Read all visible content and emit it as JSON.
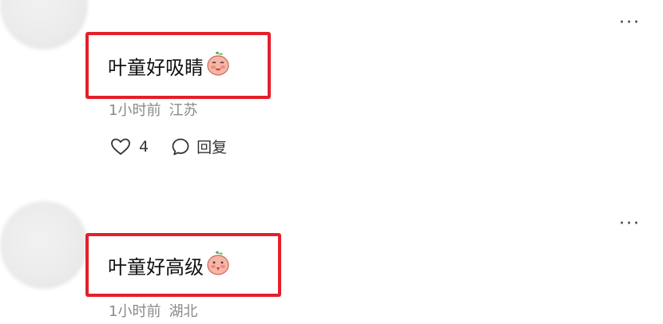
{
  "comments": [
    {
      "text": "叶童好吸睛",
      "emoji": "peach-face-emoji",
      "time": "1小时前",
      "location": "江苏",
      "likes": "4",
      "reply_label": "回复",
      "more_label": "···"
    },
    {
      "text": "叶童好高级",
      "emoji": "peach-face-emoji",
      "time": "1小时前",
      "location": "湖北",
      "more_label": "···"
    }
  ],
  "colors": {
    "highlight_border": "#e3202b",
    "meta_text": "#8a8a8a",
    "primary_text": "#111111"
  }
}
